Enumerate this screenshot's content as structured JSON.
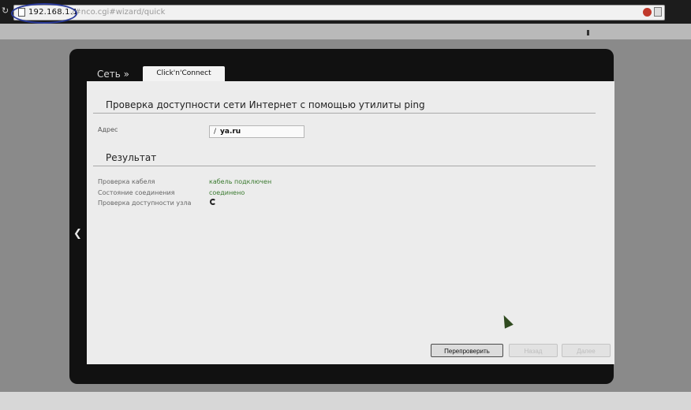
{
  "browser": {
    "url_host": "192.168.1.1",
    "url_path": "/#nco.cgi#wizard/quick"
  },
  "router": {
    "nav_link": "Сеть »",
    "active_tab": "Click'n'Connect",
    "section_title": "Проверка доступности сети Интернет с помощью утилиты ping",
    "address_label": "Адрес",
    "address_value": "ya.ru",
    "results_title": "Результат",
    "results": [
      {
        "label": "Проверка кабеля",
        "value": "кабель подключен"
      },
      {
        "label": "Состояние соединения",
        "value": "соединено"
      },
      {
        "label": "Проверка доступности узла",
        "value": ""
      }
    ],
    "buttons": {
      "recheck": "Перепроверить",
      "back": "Назад",
      "next": "Далее"
    }
  },
  "colors": {
    "status_ok": "#3a7a2f",
    "frame": "#111111",
    "panel": "#ececec"
  }
}
